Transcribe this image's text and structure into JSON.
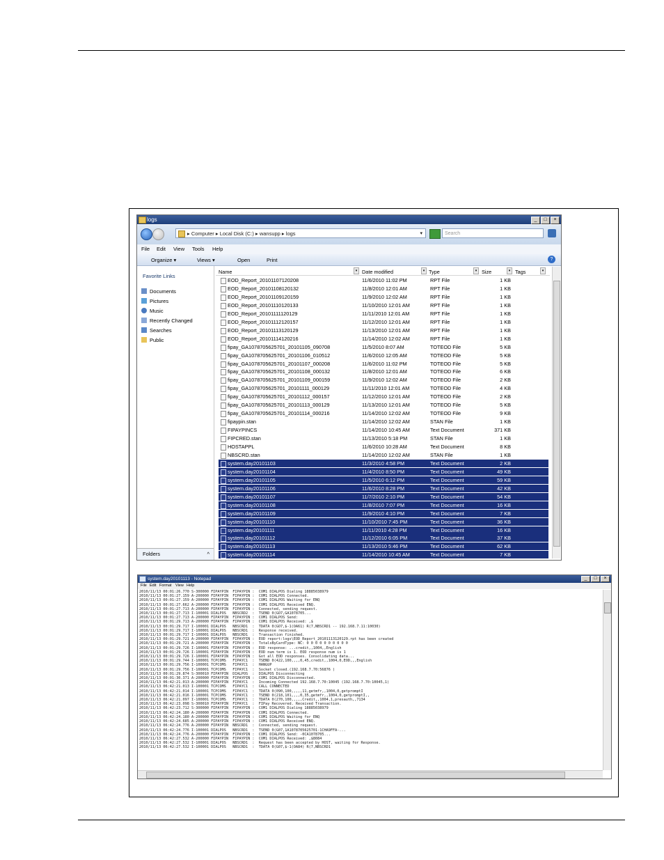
{
  "explorer": {
    "title": "logs",
    "path": "▸ Computer ▸ Local Disk (C:) ▸ wansupp ▸ logs",
    "search_placeholder": "Search",
    "menu": [
      "File",
      "Edit",
      "View",
      "Tools",
      "Help"
    ],
    "toolbar": {
      "organize": "Organize ▾",
      "views": "Views ▾",
      "open": "Open",
      "print": "Print"
    },
    "favorite_title": "Favorite Links",
    "favorites": [
      "Documents",
      "Pictures",
      "Music",
      "Recently Changed",
      "Searches",
      "Public"
    ],
    "folders_label": "Folders",
    "columns": {
      "name": "Name",
      "date": "Date modified",
      "type": "Type",
      "size": "Size",
      "tags": "Tags"
    },
    "files": [
      {
        "name": "EOD_Report_20101107120208",
        "date": "11/6/2010 11:02 PM",
        "type": "RPT File",
        "size": "1 KB",
        "sel": false
      },
      {
        "name": "EOD_Report_20101108120132",
        "date": "11/8/2010 12:01 AM",
        "type": "RPT File",
        "size": "1 KB",
        "sel": false
      },
      {
        "name": "EOD_Report_20101109120159",
        "date": "11/9/2010 12:02 AM",
        "type": "RPT File",
        "size": "1 KB",
        "sel": false
      },
      {
        "name": "EOD_Report_20101110120133",
        "date": "11/10/2010 12:01 AM",
        "type": "RPT File",
        "size": "1 KB",
        "sel": false
      },
      {
        "name": "EOD_Report_20101111120129",
        "date": "11/11/2010 12:01 AM",
        "type": "RPT File",
        "size": "1 KB",
        "sel": false
      },
      {
        "name": "EOD_Report_20101112120157",
        "date": "11/12/2010 12:01 AM",
        "type": "RPT File",
        "size": "1 KB",
        "sel": false
      },
      {
        "name": "EOD_Report_20101113120129",
        "date": "11/13/2010 12:01 AM",
        "type": "RPT File",
        "size": "1 KB",
        "sel": false
      },
      {
        "name": "EOD_Report_20101114120216",
        "date": "11/14/2010 12:02 AM",
        "type": "RPT File",
        "size": "1 KB",
        "sel": false
      },
      {
        "name": "fipay_GA1078705625701_20101105_090708",
        "date": "11/5/2010 8:07 AM",
        "type": "TOTEOD File",
        "size": "5 KB",
        "sel": false
      },
      {
        "name": "fipay_GA1078705625701_20101106_010512",
        "date": "11/6/2010 12:05 AM",
        "type": "TOTEOD File",
        "size": "5 KB",
        "sel": false
      },
      {
        "name": "fipay_GA1078705625701_20101107_000208",
        "date": "11/6/2010 11:02 PM",
        "type": "TOTEOD File",
        "size": "5 KB",
        "sel": false
      },
      {
        "name": "fipay_GA1078705625701_20101108_000132",
        "date": "11/8/2010 12:01 AM",
        "type": "TOTEOD File",
        "size": "6 KB",
        "sel": false
      },
      {
        "name": "fipay_GA1078705625701_20101109_000159",
        "date": "11/9/2010 12:02 AM",
        "type": "TOTEOD File",
        "size": "2 KB",
        "sel": false
      },
      {
        "name": "fipay_GA1078705625701_20101111_000129",
        "date": "11/11/2010 12:01 AM",
        "type": "TOTEOD File",
        "size": "4 KB",
        "sel": false
      },
      {
        "name": "fipay_GA1078705625701_20101112_000157",
        "date": "11/12/2010 12:01 AM",
        "type": "TOTEOD File",
        "size": "2 KB",
        "sel": false
      },
      {
        "name": "fipay_GA1078705625701_20101113_000129",
        "date": "11/13/2010 12:01 AM",
        "type": "TOTEOD File",
        "size": "5 KB",
        "sel": false
      },
      {
        "name": "fipay_GA1078705625701_20101114_000216",
        "date": "11/14/2010 12:02 AM",
        "type": "TOTEOD File",
        "size": "9 KB",
        "sel": false
      },
      {
        "name": "fipaypin.stan",
        "date": "11/14/2010 12:02 AM",
        "type": "STAN File",
        "size": "1 KB",
        "sel": false
      },
      {
        "name": "FIPAYPINCS",
        "date": "11/14/2010 10:45 AM",
        "type": "Text Document",
        "size": "371 KB",
        "sel": false
      },
      {
        "name": "FIPCRED.stan",
        "date": "11/13/2010 5:18 PM",
        "type": "STAN File",
        "size": "1 KB",
        "sel": false
      },
      {
        "name": "HOSTAPPL",
        "date": "11/6/2010 10:28 AM",
        "type": "Text Document",
        "size": "8 KB",
        "sel": false
      },
      {
        "name": "NBSCRD.stan",
        "date": "11/14/2010 12:02 AM",
        "type": "STAN File",
        "size": "1 KB",
        "sel": false
      },
      {
        "name": "system.day20101103",
        "date": "11/3/2010 4:58 PM",
        "type": "Text Document",
        "size": "2 KB",
        "sel": true
      },
      {
        "name": "system.day20101104",
        "date": "11/4/2010 8:50 PM",
        "type": "Text Document",
        "size": "49 KB",
        "sel": true
      },
      {
        "name": "system.day20101105",
        "date": "11/5/2010 6:12 PM",
        "type": "Text Document",
        "size": "59 KB",
        "sel": true
      },
      {
        "name": "system.day20101106",
        "date": "11/6/2010 8:28 PM",
        "type": "Text Document",
        "size": "42 KB",
        "sel": true
      },
      {
        "name": "system.day20101107",
        "date": "11/7/2010 2:10 PM",
        "type": "Text Document",
        "size": "54 KB",
        "sel": true
      },
      {
        "name": "system.day20101108",
        "date": "11/8/2010 7:07 PM",
        "type": "Text Document",
        "size": "16 KB",
        "sel": true
      },
      {
        "name": "system.day20101109",
        "date": "11/9/2010 4:10 PM",
        "type": "Text Document",
        "size": "7 KB",
        "sel": true
      },
      {
        "name": "system.day20101110",
        "date": "11/10/2010 7:45 PM",
        "type": "Text Document",
        "size": "36 KB",
        "sel": true
      },
      {
        "name": "system.day20101111",
        "date": "11/11/2010 4:28 PM",
        "type": "Text Document",
        "size": "16 KB",
        "sel": true
      },
      {
        "name": "system.day20101112",
        "date": "11/12/2010 6:05 PM",
        "type": "Text Document",
        "size": "37 KB",
        "sel": true
      },
      {
        "name": "system.day20101113",
        "date": "11/13/2010 5:46 PM",
        "type": "Text Document",
        "size": "62 KB",
        "sel": true
      },
      {
        "name": "system.day20101114",
        "date": "11/14/2010 10:45 AM",
        "type": "Text Document",
        "size": "7 KB",
        "sel": true
      }
    ]
  },
  "notepad": {
    "title": "system.day20101113 - Notepad",
    "menu": [
      "File",
      "Edit",
      "Format",
      "View",
      "Help"
    ],
    "lines": [
      "2010/11/13 00:01:26.770 S-300000 FIPAYPIN  FIPAYPIN :  COM1 DIALPOS Dialing 18885038979",
      "2010/11/13 00:01:27.159 A-200000 FIPAYPIN  FIPAYPIN :  COM1 DIALPOS Connected.",
      "2010/11/13 00:01:27.159 A-200000 FIPAYPIN  FIPAYPIN :  COM1 DIALPOS Waiting for ENQ",
      "2010/11/13 00:01:27.662 A-200000 FIPAYPIN  FIPAYPIN :  COM1 DIALPOS Received ENQ.",
      "2010/11/13 00:01:27.713 A-200000 FIPAYPIN  FIPAYPIN :  Connected, sending request.",
      "2010/11/13 00:01:27.713 I-100001 DIALPOS   NBSCRD2  :  TSEND 0(GO7,GA1078705...",
      "2010/11/13 00:01:27.713 A-200000 FIPAYPIN  FIPAYPIN :  COM1 DIALPOS Send:",
      "2010/11/13 00:01:29.713 A-200000 FIPAYPIN  FIPAYPIN :  COM1 DIALPOS Received: ,$",
      "2010/11/13 00:01:29.717 I-100001 DIALPOS   NBSCRD1  :  TDATA 0(GO7,$-1(OA61) R(7,NBSCRD1 -- 192.168.7.11:10030)",
      "2010/11/13 00:01:29.717 I-100001 DIALPOS   NBSCRD1  :  Response received.",
      "2010/11/13 00:01:29.717 I-100001 DIALPOS   NBSCRD1  :  Transaction finished.",
      "2010/11/13 00:01:29.721 A-200000 FIPAYPIN  FIPAYPIN :  EOD report:logs\\EOD_Report_20101113120129.rpt has been created",
      "2010/11/13 00:01:29.721 A-200000 FIPAYPIN  FIPAYPIN :  TotalsByCardType: NC: 0 0 0 0 0 0 0 0 0 0",
      "2010/11/13 00:01:29.726 I-100001 FIPAYPIN  FIPAYPIN :  EOD response: ...credit,,1004,,English",
      "2010/11/13 00:01:29.726 I-100001 FIPAYPIN  FIPAYPIN :  EOD num term is 1. EOD response num is 1",
      "2010/11/13 00:01:29.726 I-100001 FIPAYPIN  FIPAYPIN :  Got all EOD responses. Consolidating data...",
      "2010/11/13 00:01:29.744 I-100001 TCPCOMS   FIPAYC1  :  TSEND 0(422,100,,,,0,45,credit,,1004,0,EOD,,,English",
      "2010/11/13 00:01:29.756 I-100001 TCPCOMS   FIPAYC1  :  HANGUP",
      "2010/11/13 00:01:29.756 I-100001 TCPCOMS   FIPAYC1  :  Socket closed.(192.168.7.70:56876 )",
      "2010/11/13 00:01:29.874 S-300010 FIPAYPIN  DIALPOS  :  DIALPOS Disconnecting",
      "2010/11/13 00:01:30.371 A-200000 FIPAYPIN  FIPAYPIN :  COM1 DIALPOS Disconnected.",
      "2010/11/13 06:42:21.013 A-200000 FIPAYPIN  FIPAYC1  :  Incoming Connected 192.168.7.70:10045 (192.168.7.70:10045,1)",
      "2010/11/13 06:42:21.013 I-100001 TCPCOMS   FIPAYC1  :  CALL CONNECTED",
      "2010/11/13 06:42:21.014 I-100001 TCPCOMS   FIPAYC1  :  TDATA 0(090,100,,,,,11,getmfr,,1004,0,getpromptI",
      "2010/11/13 06:42:21.016 I-100001 TCPCOMS   FIPAYC1  :  TSEND 0(218,101,,,,0,35,getmfr,,1004,0,getpromptI,,",
      "2010/11/13 06:42:21.097 I-100001 TCPCOMS   FIPAYC1  :  TDATA 0(270,100,,,,,Credit,,1004,1,presauth,,7134",
      "2010/11/13 06:42:23.098 S-300010 FIPAYPIN  FIPAYC1  :  FIPay Recovered. Received Transaction.",
      "2010/11/13 06:42:23.712 S-300000 FIPAYPIN  FIPAYPIN :  COM1 DIALPOS Dialing 18885038979",
      "2010/11/13 06:42:24.180 A-200000 FIPAYPIN  FIPAYPIN :  COM1 DIALPOS Connected.",
      "2010/11/13 06:42:24.180 A-200000 FIPAYPIN  FIPAYPIN :  COM1 DIALPOS Waiting for ENQ",
      "2010/11/13 06:42:24.685 A-200000 FIPAYPIN  FIPAYPIN :  COM1 DIALPOS Received ENQ.",
      "2010/11/13 06:42:24.776 A-200000 FIPAYPIN  NBSCRD1  :  Connected, sending request.",
      "2010/11/13 06:42:24.776 I-100001 DIALPOS   NBSCRD1  :  TSEND 0(G07,1A1078705625701-1CHA9FFA-...",
      "2010/11/13 06:42:24.776 A-200000 FIPAYPIN  FIPAYPIN :  COM1 DIALPOS Send: -0CA1078705...",
      "2010/11/13 06:42:27.532 A-200000 FIPAYPIN  FIPAYPIN :  COM1 DIALPOS Received: ,$8084",
      "2010/11/13 06:42:27.532 I-100001 DIALPOS   NBSCRD1  :  Request has been accepted by HOST, waiting for Response.",
      "2010/11/13 06:42:27.532 I-100001 DIALPOS   NBSCRD1  :  TDATA 0(G07,$-1(OA84) R(7,NBSCRD1"
    ]
  }
}
